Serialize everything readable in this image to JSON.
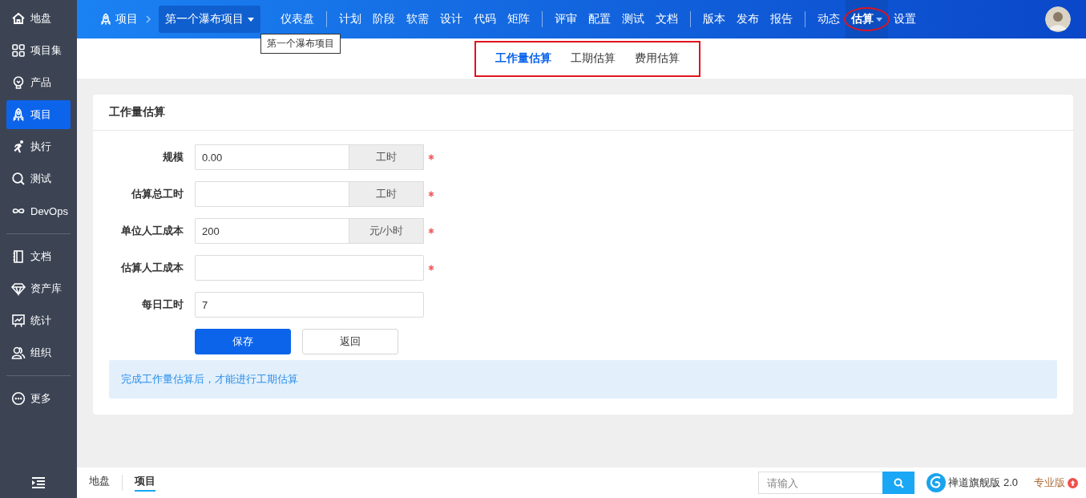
{
  "sidebar": {
    "groups": [
      [
        {
          "label": "地盘",
          "selected": false
        },
        {
          "label": "项目集",
          "selected": false
        },
        {
          "label": "产品",
          "selected": false
        },
        {
          "label": "项目",
          "selected": true
        },
        {
          "label": "执行",
          "selected": false
        },
        {
          "label": "测试",
          "selected": false
        },
        {
          "label": "DevOps",
          "selected": false
        }
      ],
      [
        {
          "label": "文档",
          "selected": false
        },
        {
          "label": "资产库",
          "selected": false
        },
        {
          "label": "统计",
          "selected": false
        },
        {
          "label": "组织",
          "selected": false
        }
      ],
      [
        {
          "label": "更多",
          "selected": false
        }
      ]
    ]
  },
  "topbar": {
    "breadcrumb": "项目",
    "project": "第一个瀑布项目",
    "tooltip": "第一个瀑布项目",
    "groups": [
      [
        {
          "label": "仪表盘",
          "selected": false,
          "dropdown": false
        }
      ],
      [
        {
          "label": "计划",
          "selected": false,
          "dropdown": false
        },
        {
          "label": "阶段",
          "selected": false,
          "dropdown": false
        },
        {
          "label": "软需",
          "selected": false,
          "dropdown": false
        },
        {
          "label": "设计",
          "selected": false,
          "dropdown": false
        },
        {
          "label": "代码",
          "selected": false,
          "dropdown": false
        },
        {
          "label": "矩阵",
          "selected": false,
          "dropdown": false
        }
      ],
      [
        {
          "label": "评审",
          "selected": false,
          "dropdown": false
        },
        {
          "label": "配置",
          "selected": false,
          "dropdown": false
        },
        {
          "label": "测试",
          "selected": false,
          "dropdown": false
        },
        {
          "label": "文档",
          "selected": false,
          "dropdown": false
        }
      ],
      [
        {
          "label": "版本",
          "selected": false,
          "dropdown": false
        },
        {
          "label": "发布",
          "selected": false,
          "dropdown": false
        },
        {
          "label": "报告",
          "selected": false,
          "dropdown": false
        }
      ],
      [
        {
          "label": "动态",
          "selected": false,
          "dropdown": false
        },
        {
          "label": "估算",
          "selected": true,
          "dropdown": true,
          "circled": true
        },
        {
          "label": "设置",
          "selected": false,
          "dropdown": false
        }
      ]
    ]
  },
  "subtabs": [
    {
      "label": "工作量估算",
      "selected": true
    },
    {
      "label": "工期估算",
      "selected": false
    },
    {
      "label": "费用估算",
      "selected": false
    }
  ],
  "card": {
    "title": "工作量估算",
    "fields": [
      {
        "label": "规模",
        "value": "0.00",
        "addon": "工时",
        "required": true
      },
      {
        "label": "估算总工时",
        "addon": "工时",
        "required": true
      },
      {
        "label": "单位人工成本",
        "value": "200",
        "addon": "元/小时",
        "required": true
      },
      {
        "label": "估算人工成本",
        "required": true
      },
      {
        "label": "每日工时",
        "value": "7",
        "required": false
      }
    ],
    "buttons": [
      {
        "label": "保存",
        "kind": "primary"
      },
      {
        "label": "返回",
        "kind": "default"
      }
    ],
    "notice": "完成工作量估算后，才能进行工期估算"
  },
  "footer": {
    "breadcrumbs": [
      {
        "label": "地盘",
        "selected": false
      },
      {
        "label": "项目",
        "selected": true
      }
    ],
    "search": {
      "placeholder": "请输入"
    },
    "version": "禅道旗舰版 2.0",
    "edition": "专业版"
  }
}
